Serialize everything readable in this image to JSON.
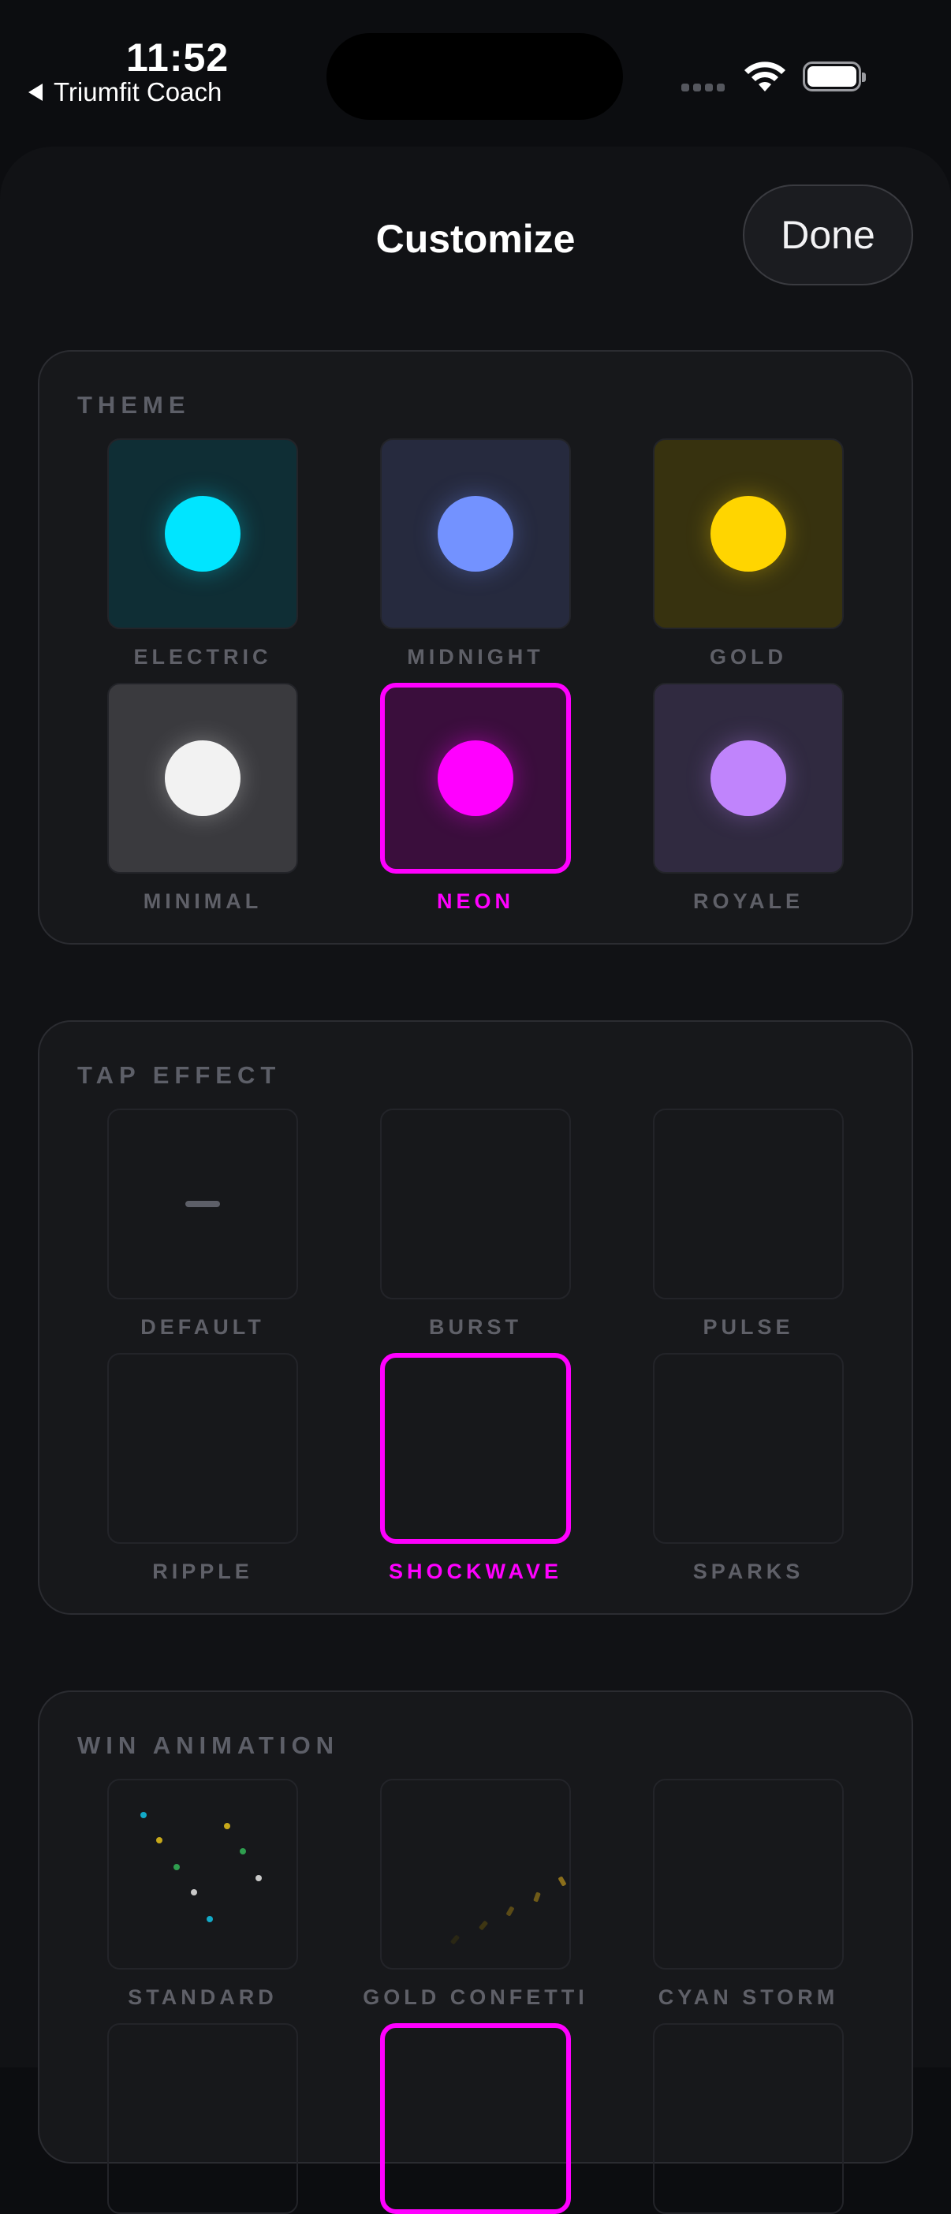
{
  "status": {
    "time": "11:52",
    "back_app": "Triumfit Coach"
  },
  "header": {
    "title": "Customize",
    "done_label": "Done"
  },
  "theme": {
    "title": "THEME",
    "selected": "NEON",
    "options": [
      {
        "label": "ELECTRIC",
        "bg": "#0f2e35",
        "dot": "#00e5ff"
      },
      {
        "label": "MIDNIGHT",
        "bg": "#262a3e",
        "dot": "#7392ff"
      },
      {
        "label": "GOLD",
        "bg": "#37320f",
        "dot": "#ffd500"
      },
      {
        "label": "MINIMAL",
        "bg": "#3a3a3e",
        "dot": "#f2f2f2"
      },
      {
        "label": "NEON",
        "bg": "#3a0e3c",
        "dot": "#ff00ff"
      },
      {
        "label": "ROYALE",
        "bg": "#302a40",
        "dot": "#c084fc"
      }
    ]
  },
  "tap_effect": {
    "title": "TAP EFFECT",
    "selected": "SHOCKWAVE",
    "options": [
      {
        "label": "DEFAULT"
      },
      {
        "label": "BURST"
      },
      {
        "label": "PULSE"
      },
      {
        "label": "RIPPLE"
      },
      {
        "label": "SHOCKWAVE"
      },
      {
        "label": "SPARKS"
      }
    ]
  },
  "win_animation": {
    "title": "WIN ANIMATION",
    "options": [
      {
        "label": "STANDARD"
      },
      {
        "label": "GOLD CONFETTI"
      },
      {
        "label": "CYAN STORM"
      }
    ]
  },
  "colors": {
    "accent": "#ff00ff",
    "label": "#5f6068",
    "card_bg": "#17181b"
  },
  "icons": {
    "wifi": "wifi-icon",
    "battery": "battery-icon",
    "back": "back-triangle-icon",
    "signal": "signal-dots-icon"
  }
}
